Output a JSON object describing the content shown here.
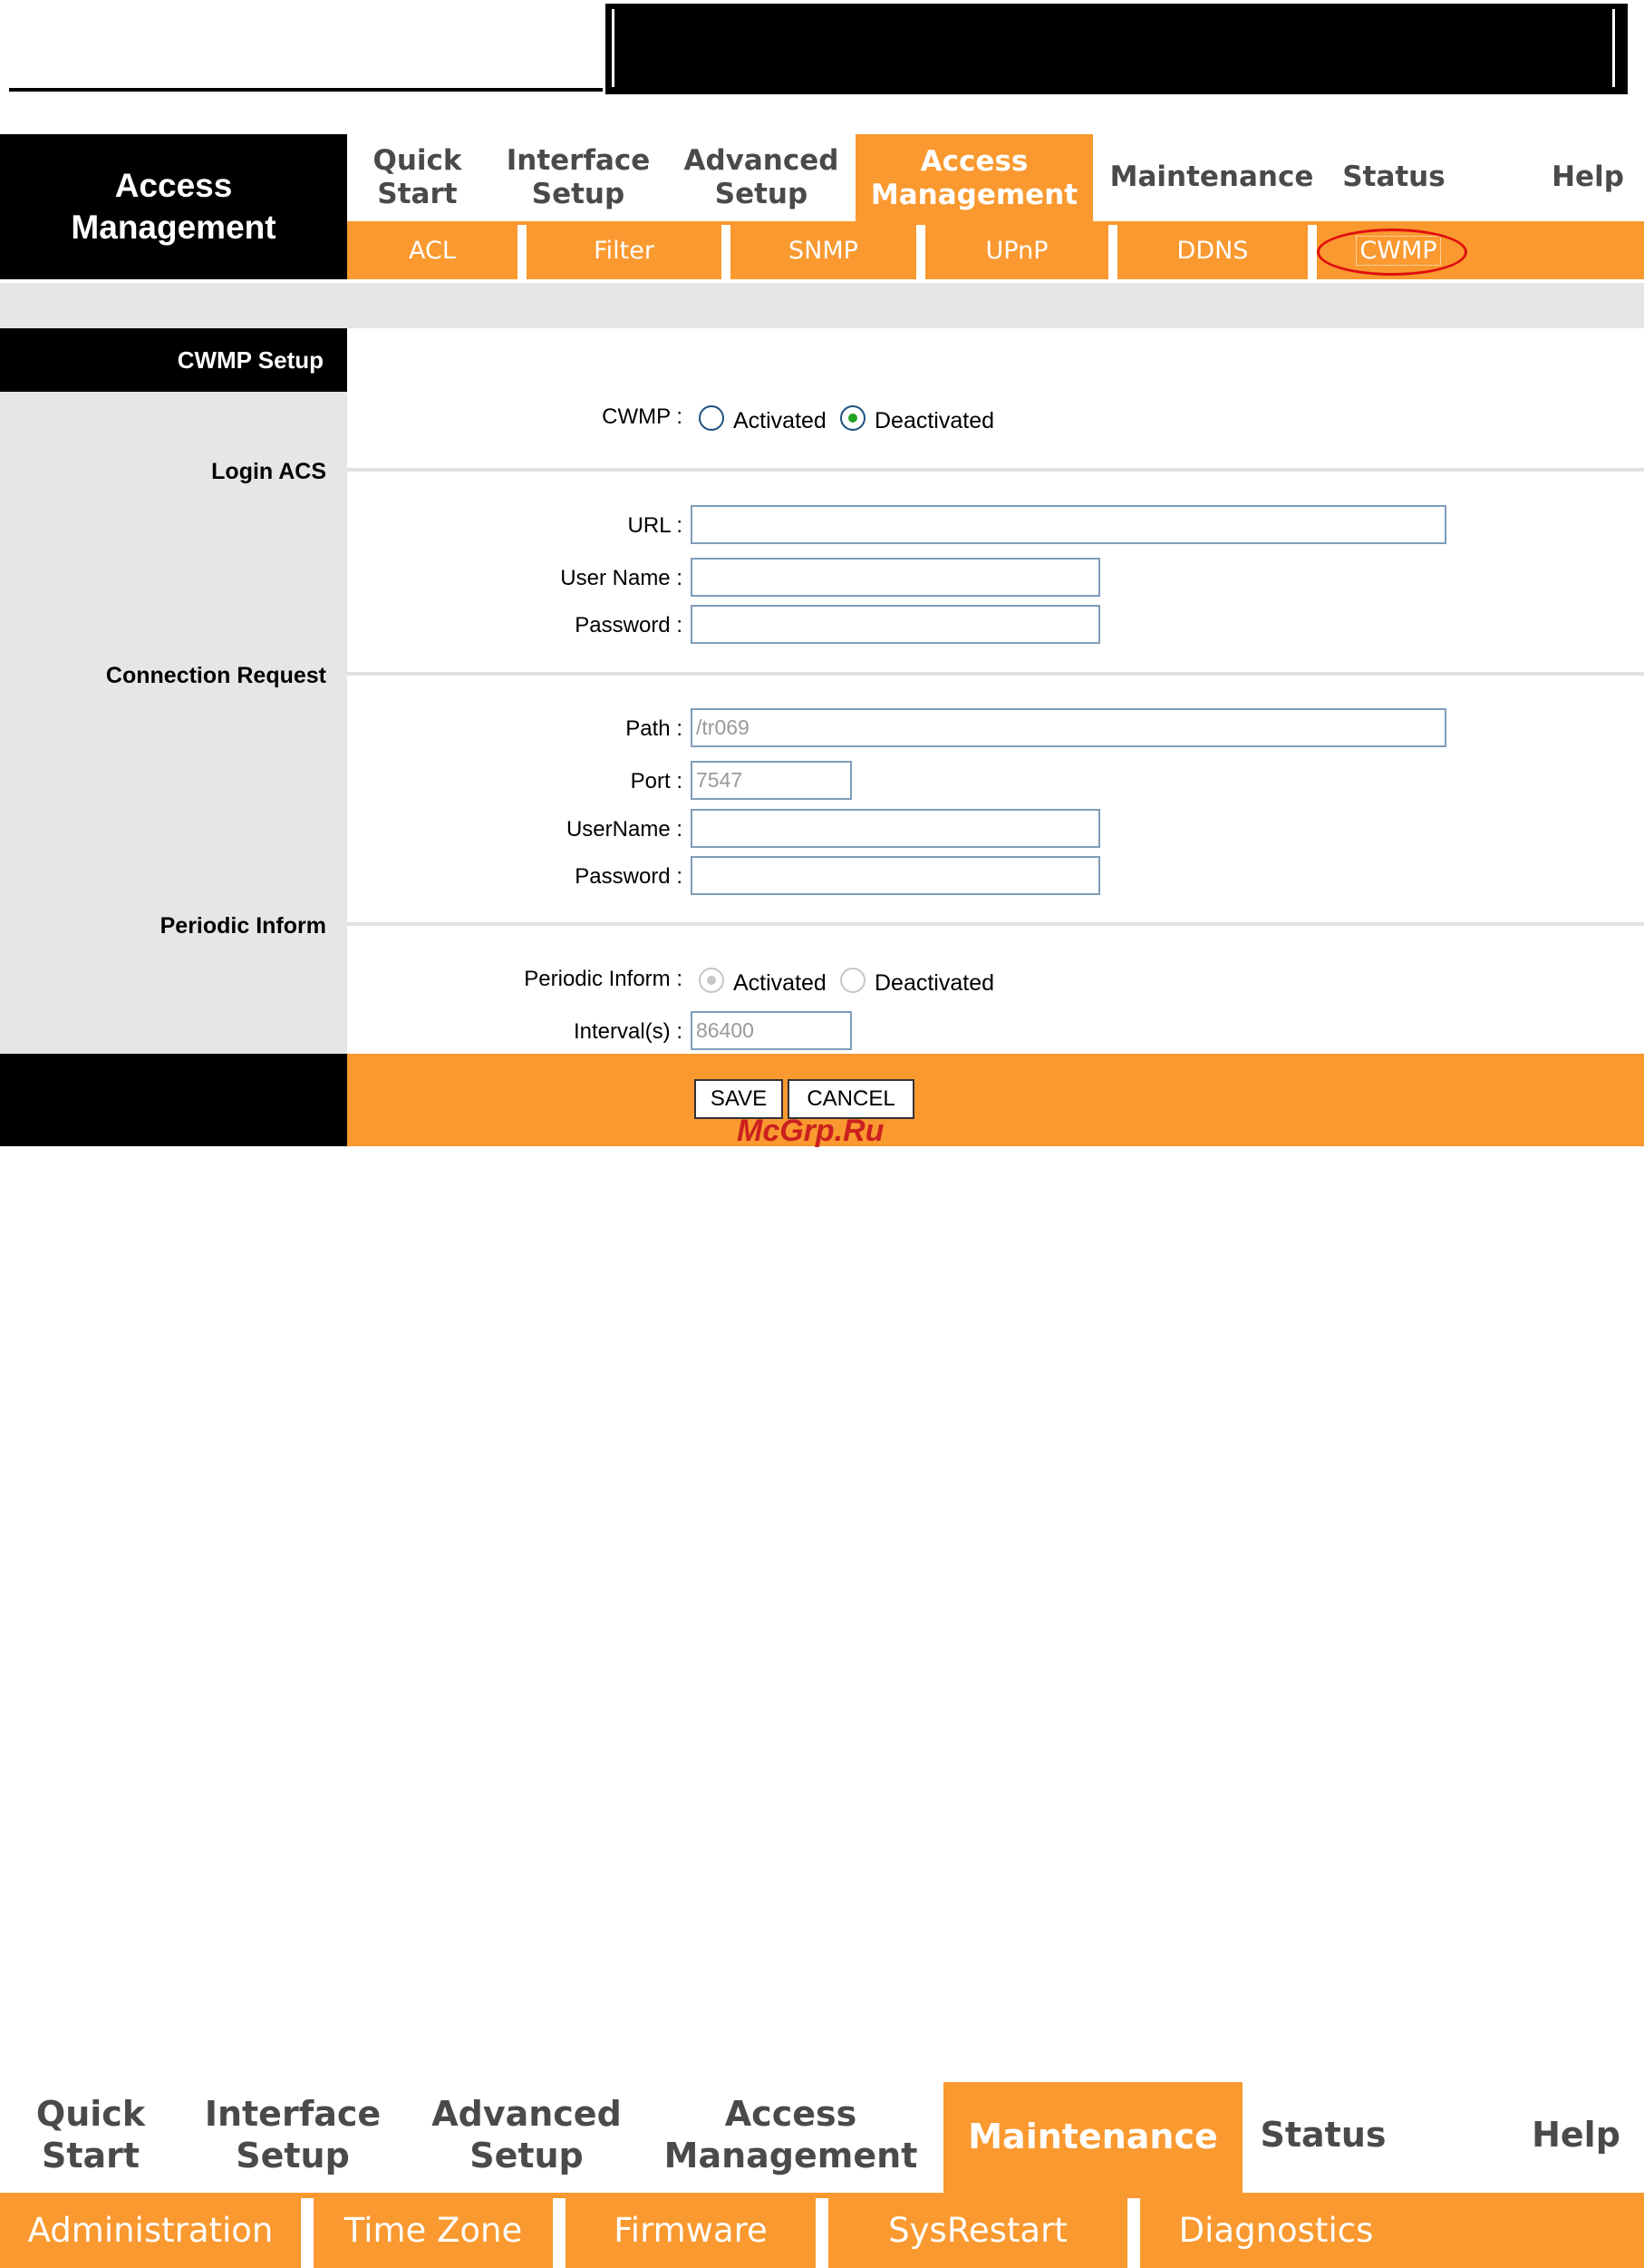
{
  "panel1": {
    "section_title_lines": [
      "Access",
      "Management"
    ],
    "tabs": [
      {
        "lines": [
          "Quick",
          "Start"
        ]
      },
      {
        "lines": [
          "Interface",
          "Setup"
        ]
      },
      {
        "lines": [
          "Advanced",
          "Setup"
        ]
      },
      {
        "lines": [
          "Access",
          "Management"
        ],
        "active": true
      },
      {
        "lines": [
          "Maintenance"
        ]
      },
      {
        "lines": [
          "Status"
        ]
      },
      {
        "lines": [
          "Help"
        ]
      }
    ],
    "subtabs": [
      "ACL",
      "Filter",
      "SNMP",
      "UPnP",
      "DDNS",
      "CWMP"
    ],
    "active_subtab": "CWMP",
    "cwmp_setup_title": "CWMP Setup",
    "cwmp_label": "CWMP :",
    "cwmp_options": [
      "Activated",
      "Deactivated"
    ],
    "cwmp_selected": "Deactivated",
    "login_acs": {
      "title": "Login ACS",
      "url_label": "URL :",
      "url_value": "",
      "username_label": "User Name :",
      "username_value": "",
      "password_label": "Password :",
      "password_value": ""
    },
    "connection_request": {
      "title": "Connection Request",
      "path_label": "Path :",
      "path_value": "/tr069",
      "port_label": "Port :",
      "port_value": "7547",
      "username_label": "UserName :",
      "username_value": "",
      "password_label": "Password :",
      "password_value": ""
    },
    "periodic_inform": {
      "title": "Periodic Inform",
      "label": "Periodic Inform :",
      "options": [
        "Activated",
        "Deactivated"
      ],
      "selected": "Activated",
      "interval_label": "Interval(s) :",
      "interval_value": "86400"
    },
    "save_label": "SAVE",
    "cancel_label": "CANCEL",
    "watermark": "McGrp.Ru"
  },
  "panel2": {
    "tabs": [
      {
        "lines": [
          "Quick",
          "Start"
        ]
      },
      {
        "lines": [
          "Interface",
          "Setup"
        ]
      },
      {
        "lines": [
          "Advanced",
          "Setup"
        ]
      },
      {
        "lines": [
          "Access",
          "Management"
        ]
      },
      {
        "lines": [
          "Maintenance"
        ],
        "active": true
      },
      {
        "lines": [
          "Status"
        ]
      },
      {
        "lines": [
          "Help"
        ]
      }
    ],
    "subtabs": [
      "Administration",
      "Time Zone",
      "Firmware",
      "SysRestart",
      "Diagnostics"
    ]
  },
  "colors": {
    "accent": "#f9992f",
    "highlight_circle": "#e01010",
    "sidebar": "#e6e6e6"
  }
}
